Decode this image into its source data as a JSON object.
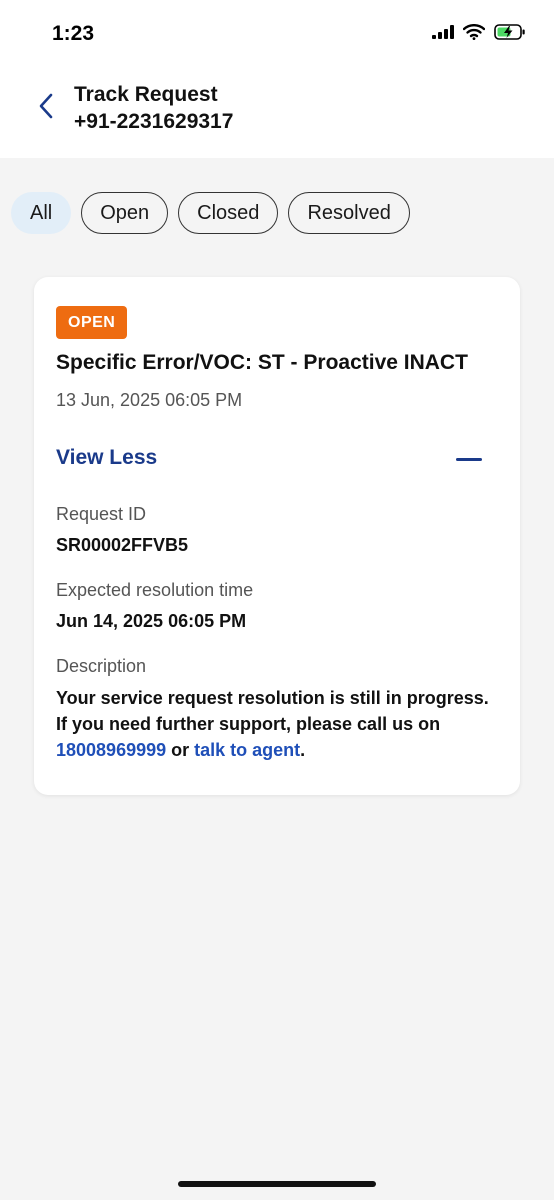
{
  "status_bar": {
    "time": "1:23",
    "icons": [
      "signal-icon",
      "wifi-icon",
      "battery-charging-icon"
    ]
  },
  "header": {
    "title": "Track Request",
    "subtitle": "+91-2231629317",
    "back_icon": "chevron-left-icon"
  },
  "filters": [
    {
      "label": "All",
      "active": true
    },
    {
      "label": "Open",
      "active": false
    },
    {
      "label": "Closed",
      "active": false
    },
    {
      "label": "Resolved",
      "active": false
    }
  ],
  "request": {
    "status": "OPEN",
    "title": "Specific Error/VOC: ST - Proactive INACT",
    "date": "13 Jun, 2025 06:05 PM",
    "toggle_label": "View Less",
    "request_id_label": "Request ID",
    "request_id": "SR00002FFVB5",
    "resolution_label": "Expected resolution time",
    "resolution_time": "Jun 14, 2025 06:05 PM",
    "description_label": "Description",
    "description_prefix": "Your service request resolution is still in progress. If you need further support, please call us on ",
    "phone_link": "18008969999",
    "description_middle": " or ",
    "agent_link": "talk to agent",
    "description_suffix": "."
  },
  "colors": {
    "accent": "#1a3a8a",
    "link": "#1f4fb8",
    "badge_open": "#ee6c11",
    "chip_active_bg": "#e2eef8",
    "page_bg": "#f4f4f4"
  }
}
